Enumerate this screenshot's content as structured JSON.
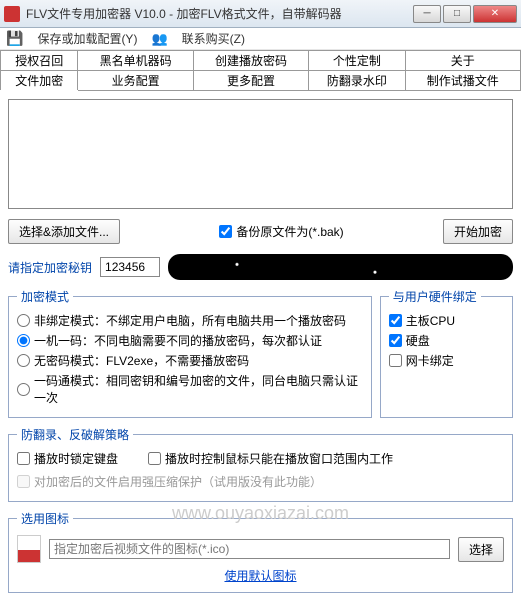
{
  "titlebar": {
    "title": "FLV文件专用加密器 V10.0 - 加密FLV格式文件，自带解码器"
  },
  "menubar": {
    "save_config": "保存或加载配置(Y)",
    "contact": "联系购买(Z)"
  },
  "tabs_row1": [
    "授权召回",
    "黑名单机器码",
    "创建播放密码",
    "个性定制",
    "关于"
  ],
  "tabs_row2": [
    "文件加密",
    "业务配置",
    "更多配置",
    "防翻录水印",
    "制作试播文件"
  ],
  "active_tab": "文件加密",
  "buttons": {
    "select_files": "选择&添加文件...",
    "start_encrypt": "开始加密",
    "select_icon": "选择"
  },
  "backup": {
    "label": "备份原文件为(*.bak)",
    "checked": true
  },
  "secret": {
    "label": "请指定加密秘钥",
    "value": "123456"
  },
  "mode": {
    "legend": "加密模式",
    "options": [
      "非绑定模式：不绑定用户电脑，所有电脑共用一个播放密码",
      "一机一码：不同电脑需要不同的播放密码，每次都认证",
      "无密码模式：FLV2exe，不需要播放密码",
      "一码通模式：相同密钥和编号加密的文件，同台电脑只需认证一次"
    ],
    "selected": 1
  },
  "hardware": {
    "legend": "与用户硬件绑定",
    "items": [
      {
        "label": "主板CPU",
        "checked": true
      },
      {
        "label": "硬盘",
        "checked": true
      },
      {
        "label": "网卡绑定",
        "checked": false
      }
    ]
  },
  "antirec": {
    "legend": "防翻录、反破解策略",
    "opt1": "播放时锁定键盘",
    "opt2": "播放时控制鼠标只能在播放窗口范围内工作",
    "opt3": "对加密后的文件启用强压缩保护（试用版没有此功能）"
  },
  "iconsel": {
    "legend": "选用图标",
    "placeholder": "指定加密后视频文件的图标(*.ico)",
    "default_link": "使用默认图标"
  },
  "watermark": "www.ouyaoxiazai.com"
}
